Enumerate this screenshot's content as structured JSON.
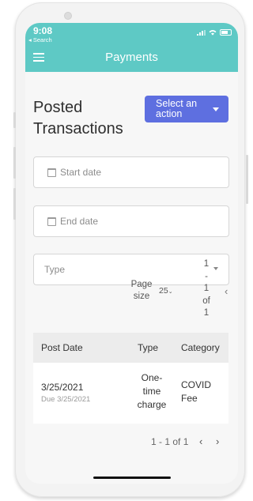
{
  "status_bar": {
    "time": "9:08",
    "back_label": "◂ Search"
  },
  "app_bar": {
    "title": "Payments"
  },
  "page": {
    "title": "Posted Transactions"
  },
  "action_button": {
    "label": "Select an action"
  },
  "filters": {
    "start_date_placeholder": "Start date",
    "end_date_placeholder": "End date",
    "type_placeholder": "Type"
  },
  "pagination_top": {
    "page_size_label": "Page size",
    "page_size_value": "25",
    "range_lines": [
      "1",
      "-",
      "1",
      "of",
      "1"
    ],
    "prev_icon": "‹"
  },
  "table": {
    "columns": [
      "Post Date",
      "Type",
      "Category"
    ],
    "rows": [
      {
        "post_date": "3/25/2021",
        "due": "Due 3/25/2021",
        "type": "One-time charge",
        "category": "COVID Fee"
      }
    ]
  },
  "pagination_bottom": {
    "range": "1 - 1 of 1",
    "prev": "‹",
    "next": "›"
  },
  "colors": {
    "header": "#5ec9c5",
    "action_button": "#5e6fe0",
    "background": "#f7f7f7"
  }
}
